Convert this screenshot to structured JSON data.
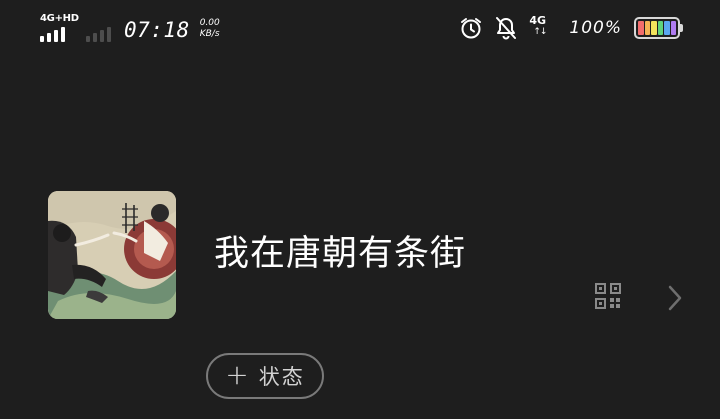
{
  "status_bar": {
    "network_label": "4G+HD",
    "time": "07:18",
    "speed_value": "0.00",
    "speed_unit": "KB/s",
    "net_type": "4G",
    "net_arrows": "↑↓",
    "battery_percent": "100%",
    "battery_colors": [
      "#f26d6d",
      "#f5b455",
      "#f2e35c",
      "#5fd37b",
      "#5aa7f0",
      "#b07cf0"
    ],
    "icons": [
      "signal-icon",
      "signal-secondary-icon",
      "alarm-icon",
      "bell-muted-icon",
      "network-4g-icon",
      "battery-icon"
    ]
  },
  "profile": {
    "nickname": "我在唐朝有条街",
    "avatar": "avatar",
    "qr_icon": "qr-code-icon",
    "chevron_icon": "chevron-right-icon"
  },
  "status_button": {
    "plus": "+",
    "label": "状态"
  }
}
